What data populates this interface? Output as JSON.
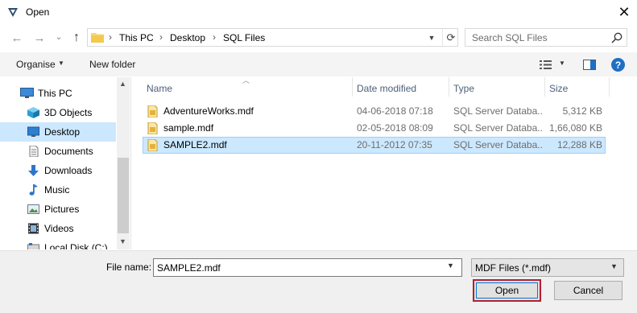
{
  "window": {
    "title": "Open",
    "close": "✕"
  },
  "nav": {
    "back": "←",
    "forward": "→",
    "recent": "⌄",
    "up": "↑"
  },
  "address": {
    "crumbs": [
      "This PC",
      "Desktop",
      "SQL Files"
    ],
    "separator": "›"
  },
  "search": {
    "placeholder": "Search SQL Files"
  },
  "toolbar": {
    "organise": "Organise",
    "new_folder": "New folder",
    "help": "?"
  },
  "sidebar": {
    "items": [
      {
        "label": "This PC",
        "icon": "computer-icon"
      },
      {
        "label": "3D Objects",
        "icon": "cube-icon"
      },
      {
        "label": "Desktop",
        "icon": "desktop-icon",
        "selected": true
      },
      {
        "label": "Documents",
        "icon": "document-icon"
      },
      {
        "label": "Downloads",
        "icon": "download-arrow-icon"
      },
      {
        "label": "Music",
        "icon": "music-note-icon"
      },
      {
        "label": "Pictures",
        "icon": "picture-icon"
      },
      {
        "label": "Videos",
        "icon": "film-icon"
      },
      {
        "label": "Local Disk (C:)",
        "icon": "drive-icon"
      }
    ]
  },
  "columns": {
    "name": "Name",
    "date": "Date modified",
    "type": "Type",
    "size": "Size"
  },
  "files": [
    {
      "name": "AdventureWorks.mdf",
      "date": "04-06-2018 07:18",
      "type": "SQL Server Databa...",
      "size": "5,312 KB"
    },
    {
      "name": "sample.mdf",
      "date": "02-05-2018 08:09",
      "type": "SQL Server Databa...",
      "size": "1,66,080 KB"
    },
    {
      "name": "SAMPLE2.mdf",
      "date": "20-11-2012 07:35",
      "type": "SQL Server Databa...",
      "size": "12,288 KB",
      "selected": true
    }
  ],
  "bottom": {
    "file_name_label": "File name:",
    "file_name_value": "SAMPLE2.mdf",
    "filter_value": "MDF Files (*.mdf)",
    "open_label": "Open",
    "cancel_label": "Cancel"
  },
  "colors": {
    "selection": "#cce8ff",
    "selection_border": "#99d1ff",
    "accent": "#0078d7",
    "open_outline": "#b51f30"
  }
}
